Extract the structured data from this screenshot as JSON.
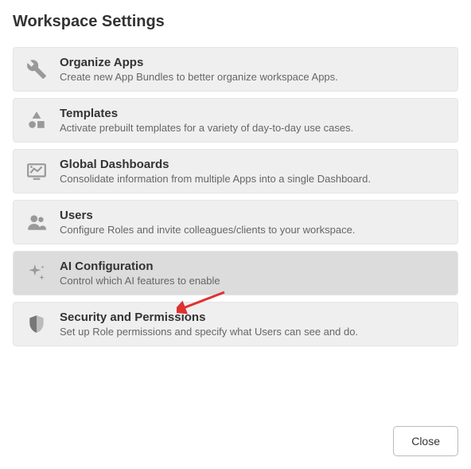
{
  "header": {
    "title": "Workspace Settings"
  },
  "items": [
    {
      "icon": "tools-icon",
      "title": "Organize Apps",
      "desc": "Create new App Bundles to better organize workspace Apps."
    },
    {
      "icon": "shapes-icon",
      "title": "Templates",
      "desc": "Activate prebuilt templates for a variety of day-to-day use cases."
    },
    {
      "icon": "dashboard-icon",
      "title": "Global Dashboards",
      "desc": "Consolidate information from multiple Apps into a single Dashboard."
    },
    {
      "icon": "users-icon",
      "title": "Users",
      "desc": "Configure Roles and invite colleagues/clients to your workspace."
    },
    {
      "icon": "sparkle-icon",
      "title": "AI Configuration",
      "desc": "Control which AI features to enable"
    },
    {
      "icon": "shield-icon",
      "title": "Security and Permissions",
      "desc": "Set up Role permissions and specify what Users can see and do."
    }
  ],
  "footer": {
    "close_label": "Close"
  }
}
